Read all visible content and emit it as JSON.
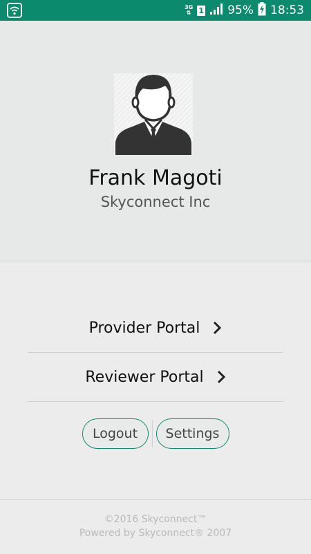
{
  "status_bar": {
    "network_type": "3G",
    "sim_slot": "1",
    "battery_percent": "95%",
    "time": "18:53",
    "icons": [
      "wifi-icon",
      "data-transfer-icon",
      "sim-icon",
      "signal-icon",
      "battery-charging-icon"
    ],
    "background_color": "#0b8a6e"
  },
  "profile": {
    "avatar_icon": "user-avatar-icon",
    "name": "Frank Magoti",
    "company": "Skyconnect Inc"
  },
  "menu": {
    "items": [
      {
        "label": "Provider Portal",
        "icon": "chevron-right-icon"
      },
      {
        "label": "Reviewer Portal",
        "icon": "chevron-right-icon"
      }
    ]
  },
  "actions": {
    "logout_label": "Logout",
    "settings_label": "Settings",
    "accent_color": "#0b8a6e"
  },
  "footer": {
    "copyright": "©2016 Skyconnect™",
    "powered_by": "Powered by Skyconnect® 2007"
  }
}
